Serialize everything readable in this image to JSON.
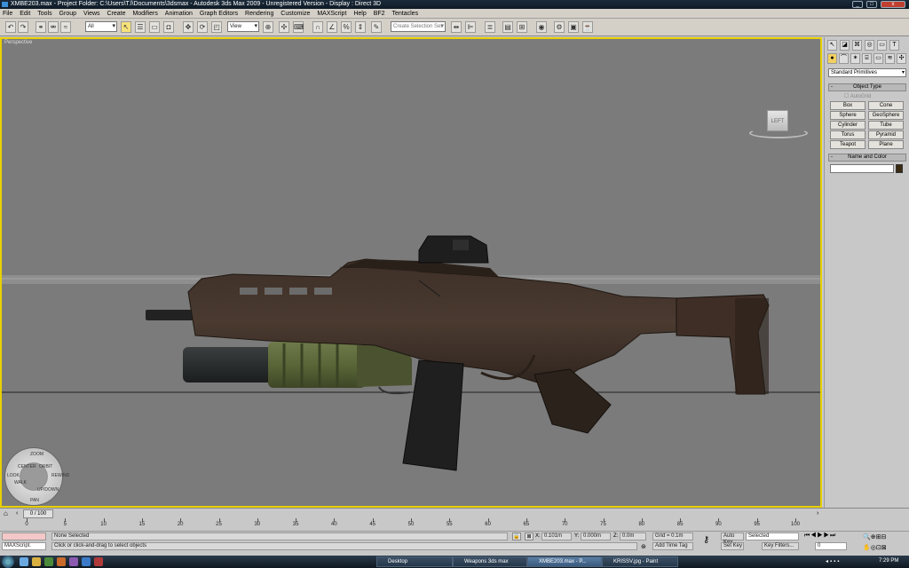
{
  "window": {
    "title": "XMBE203.max   - Project Folder: C:\\Users\\T.l\\Documents\\3dsmax    - Autodesk 3ds Max  2009    - Unregistered Version      - Display : Direct 3D",
    "controls": [
      "_",
      "□",
      "x"
    ]
  },
  "menubar": {
    "items": [
      "File",
      "Edit",
      "Tools",
      "Group",
      "Views",
      "Create",
      "Modifiers",
      "Animation",
      "Graph Editors",
      "Rendering",
      "Customize",
      "MAXScript",
      "Help",
      "BF2",
      "Tentacles"
    ]
  },
  "toolbar": {
    "selection_filter": "All",
    "reference_coord": "View",
    "named_selection_placeholder": "Create Selection Set"
  },
  "viewport": {
    "label": "Perspective",
    "viewcube_face": "LEFT",
    "background_color": "#7b7b7b",
    "border_color": "#e8d000",
    "steering_wheel": [
      "ZOOM",
      "ORBIT",
      "CENTER",
      "WALK",
      "REWIND",
      "PAN",
      "UP/DOWN",
      "LOOK"
    ]
  },
  "command_panel": {
    "category_dropdown": "Standard Primitives",
    "object_type_title": "Object Type",
    "autogrid_label": "AutoGrid",
    "object_buttons": [
      "Box",
      "Cone",
      "Sphere",
      "GeoSphere",
      "Cylinder",
      "Tube",
      "Torus",
      "Pyramid",
      "Teapot",
      "Plane"
    ],
    "name_color_title": "Name and Color",
    "name_value": "",
    "swatch_color": "#3a2a12"
  },
  "timeslider": {
    "label": "0 / 100",
    "ticks": [
      "0",
      "5",
      "10",
      "15",
      "20",
      "25",
      "30",
      "35",
      "40",
      "45",
      "50",
      "55",
      "60",
      "65",
      "70",
      "75",
      "80",
      "85",
      "90",
      "95",
      "100"
    ]
  },
  "status": {
    "maxscript_label": "MAXScript.",
    "selection_status": "None Selected",
    "prompt": "Click or click-and-drag to select objects",
    "x_label": "X:",
    "x_value": "0.101m",
    "y_label": "Y:",
    "y_value": "0.000m",
    "z_label": "Z:",
    "z_value": "0.0m",
    "grid": "Grid = 0.1m",
    "add_time_tag": "Add Time Tag",
    "auto_key": "Auto Key",
    "set_key": "Set Key",
    "key_mode_value": "Selected",
    "key_filters": "Key Filters...",
    "frame_value": "0"
  },
  "taskbar": {
    "tasks": [
      "Desktop",
      "Weapons 3ds max",
      "XMBE203.max - P...",
      "KRISSV.jpg - Paint"
    ],
    "clock": "7:29 PM"
  }
}
